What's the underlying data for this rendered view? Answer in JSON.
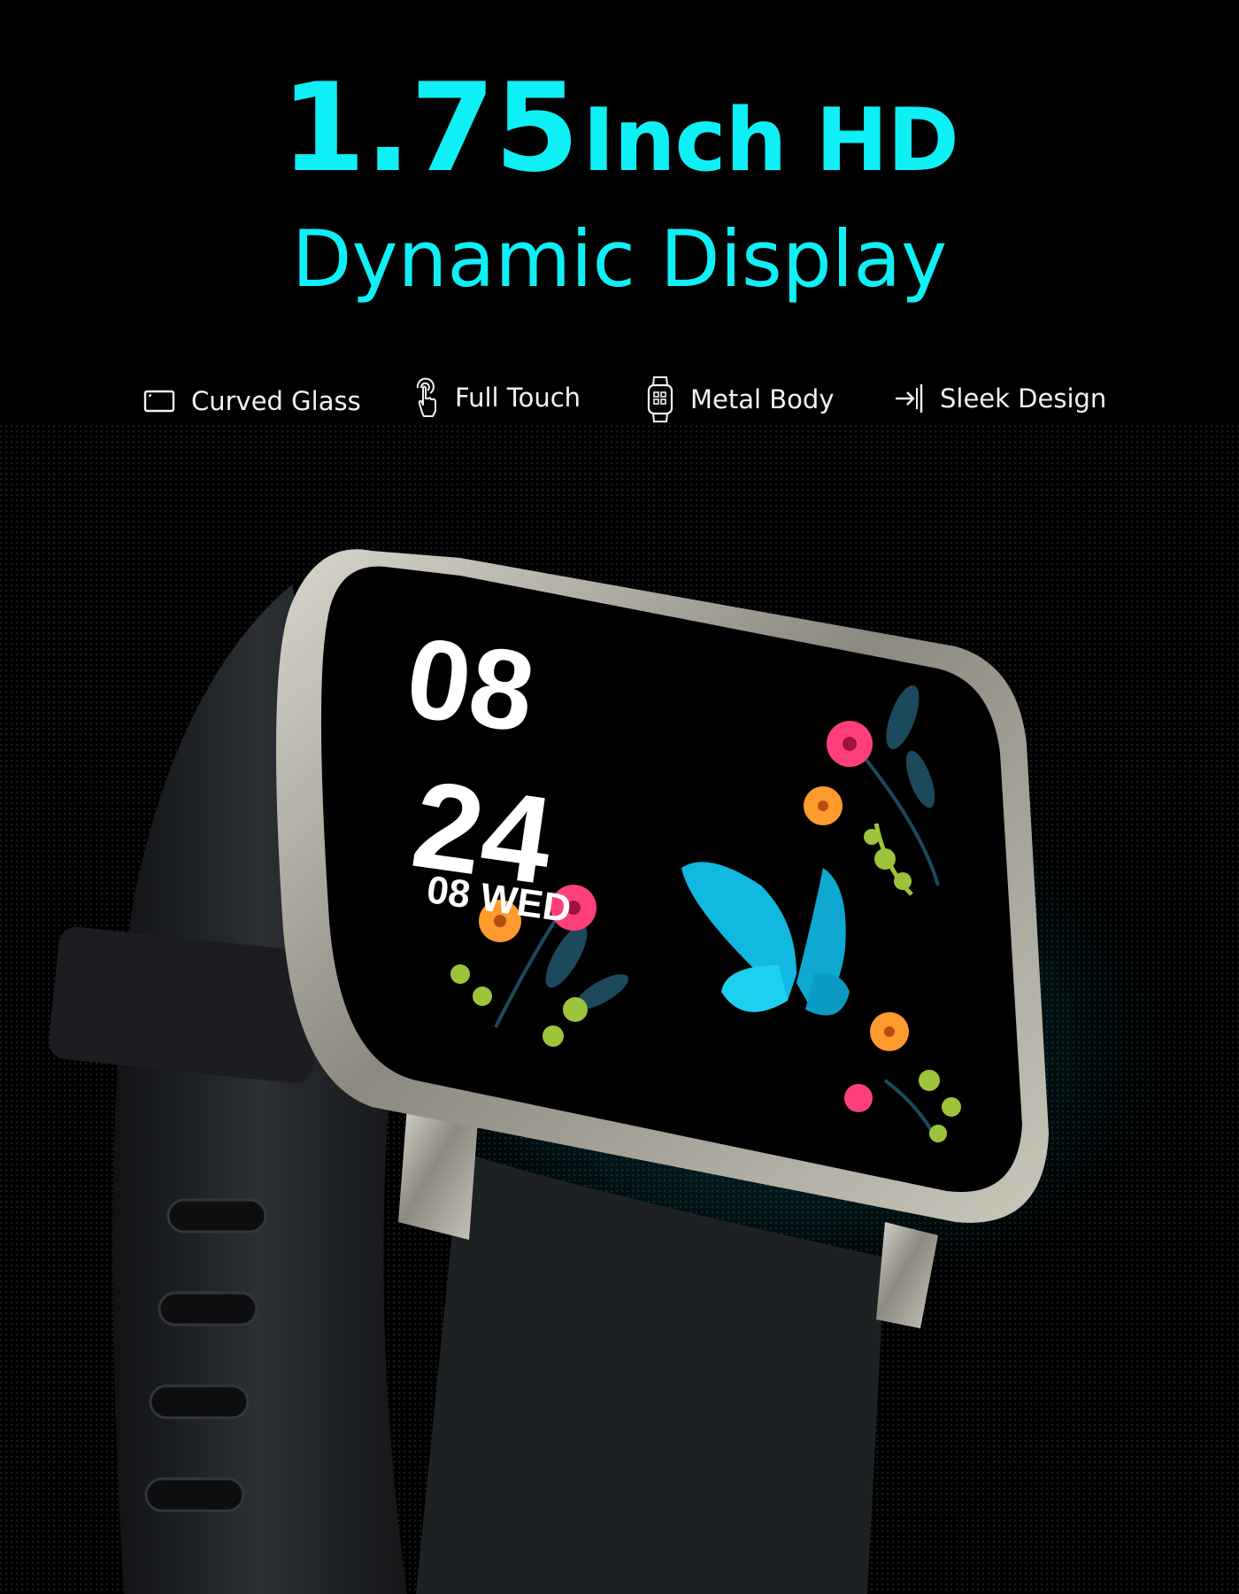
{
  "headline": {
    "size_text": "1.75",
    "size_suffix": "Inch HD",
    "subtitle": "Dynamic Display",
    "color": "#0ff0f6"
  },
  "features": [
    {
      "label": "Curved Glass",
      "icon": "curved-glass-icon"
    },
    {
      "label": "Full Touch",
      "icon": "touch-hand-icon"
    },
    {
      "label": "Metal Body",
      "icon": "watch-icon"
    },
    {
      "label": "Sleek Design",
      "icon": "arrow-to-bar-icon"
    }
  ],
  "watch_face": {
    "hour": "08",
    "minute": "24",
    "date": "08 WED",
    "butterfly_color": "#11b8e0",
    "flower_colors": [
      "#ff3f7a",
      "#ff9a2e",
      "#9cc43a",
      "#1c4a5c"
    ]
  }
}
